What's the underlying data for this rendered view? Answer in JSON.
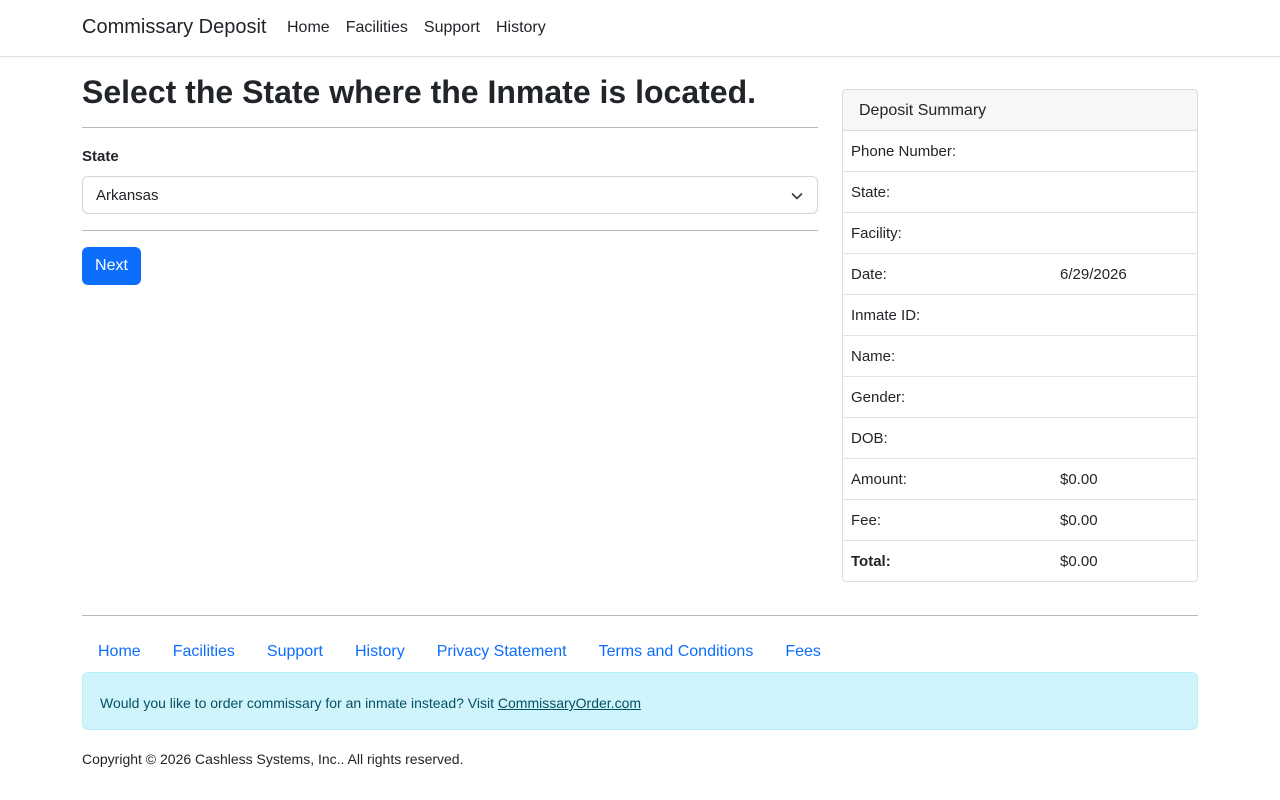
{
  "navbar": {
    "brand": "Commissary Deposit",
    "links": [
      "Home",
      "Facilities",
      "Support",
      "History"
    ]
  },
  "main": {
    "title": "Select the State where the Inmate is located.",
    "state_label": "State",
    "state_value": "Arkansas",
    "next_label": "Next"
  },
  "summary": {
    "header": "Deposit Summary",
    "rows": [
      {
        "label": "Phone Number:",
        "value": ""
      },
      {
        "label": "State:",
        "value": ""
      },
      {
        "label": "Facility:",
        "value": ""
      },
      {
        "label": "Date:",
        "value": "6/29/2026"
      },
      {
        "label": "Inmate ID:",
        "value": ""
      },
      {
        "label": "Name:",
        "value": ""
      },
      {
        "label": "Gender:",
        "value": ""
      },
      {
        "label": "DOB:",
        "value": ""
      },
      {
        "label": "Amount:",
        "value": "$0.00"
      },
      {
        "label": "Fee:",
        "value": "$0.00"
      },
      {
        "label": "Total:",
        "value": "$0.00"
      }
    ]
  },
  "footer": {
    "links": [
      "Home",
      "Facilities",
      "Support",
      "History",
      "Privacy Statement",
      "Terms and Conditions",
      "Fees"
    ],
    "alert_text": "Would you like to order commissary for an inmate instead? Visit ",
    "alert_link": "CommissaryOrder.com",
    "copyright": "Copyright © 2026 Cashless Systems, Inc.. All rights reserved."
  },
  "colors": {
    "primary": "#0d6efd",
    "alert_bg": "#cff4fc",
    "alert_text": "#055160"
  },
  "icons": {
    "select_caret": "chevron-down-icon"
  }
}
